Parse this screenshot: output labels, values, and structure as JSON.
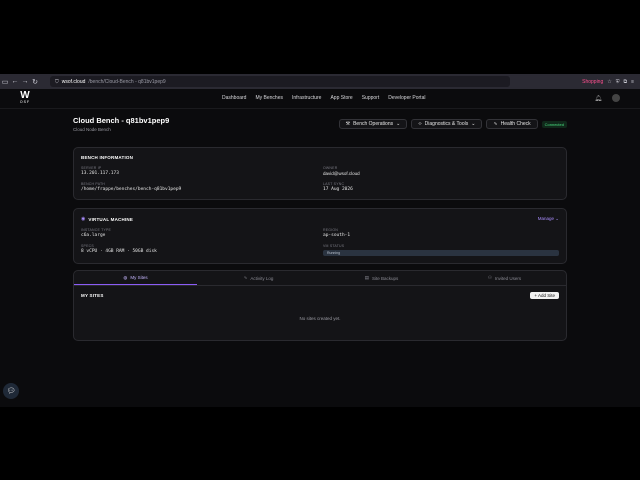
{
  "browser": {
    "url_domain": "wsof.cloud",
    "url_path": "/bench/Cloud-Bench - q81bv1pep9",
    "shopping_label": "Shopping"
  },
  "nav": {
    "logo_letter": "W",
    "logo_sub": "OSF",
    "links": [
      "Dashboard",
      "My Benches",
      "Infrastructure",
      "App Store",
      "Support",
      "Developer Portal"
    ]
  },
  "header": {
    "title": "Cloud Bench - q81bv1pep9",
    "subtitle": "Cloud Node Bench",
    "btn_bench_ops": "Bench Operations",
    "btn_diagnostics": "Diagnostics & Tools",
    "btn_health": "Health Check",
    "status": "Connected"
  },
  "bench_info": {
    "title": "BENCH INFORMATION",
    "server_ip_label": "SERVER IP",
    "server_ip": "13.201.117.173",
    "owner_label": "OWNER",
    "owner": "david@wsof.cloud",
    "bench_path_label": "BENCH PATH",
    "bench_path": "/home/frappe/benches/bench-q81bv1pep9",
    "last_sync_label": "LAST SYNC",
    "last_sync": "17 Aug 2026"
  },
  "vm": {
    "title": "VIRTUAL MACHINE",
    "manage": "Manage",
    "instance_type_label": "INSTANCE TYPE",
    "instance_type": "c6a.large",
    "region_label": "REGION",
    "region": "ap-south-1",
    "specs_label": "SPECS",
    "specs": "8 vCPU · 4GB RAM · 50GB disk",
    "vm_status_label": "VM STATUS",
    "vm_status": "Running"
  },
  "tabs": [
    {
      "label": "My Sites",
      "icon": "globe-icon"
    },
    {
      "label": "Activity Log",
      "icon": "activity-icon"
    },
    {
      "label": "Site Backups",
      "icon": "backup-icon"
    },
    {
      "label": "Invited Users",
      "icon": "users-icon"
    }
  ],
  "sites": {
    "title": "MY SITES",
    "add_button": "+ Add Site",
    "empty": "No sites created yet."
  },
  "colors": {
    "accent": "#8b5cf6",
    "status_green": "#4ade80"
  }
}
